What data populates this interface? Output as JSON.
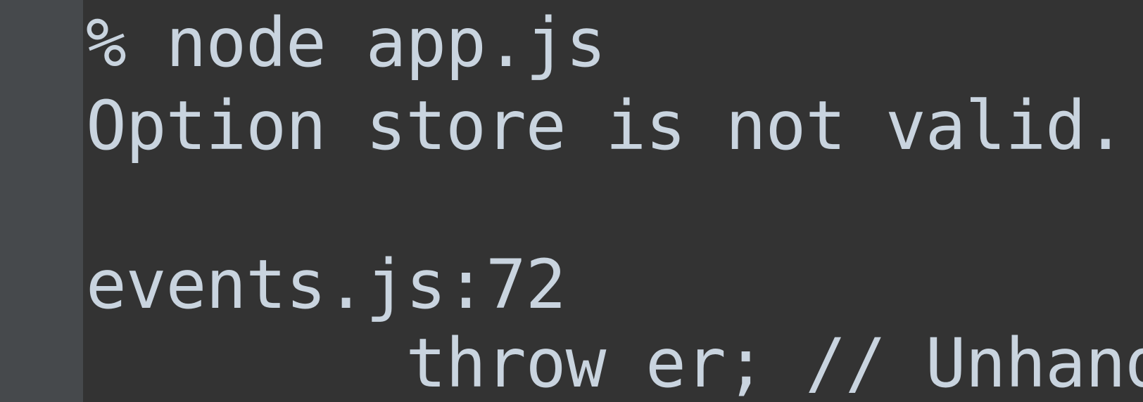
{
  "terminal": {
    "lines": [
      "% node app.js",
      "Option store is not valid. Plea",
      "",
      "events.js:72",
      "        throw er; // Unhandled"
    ]
  },
  "colors": {
    "background": "#333333",
    "gutter": "#46494c",
    "text": "#c9d4df"
  }
}
